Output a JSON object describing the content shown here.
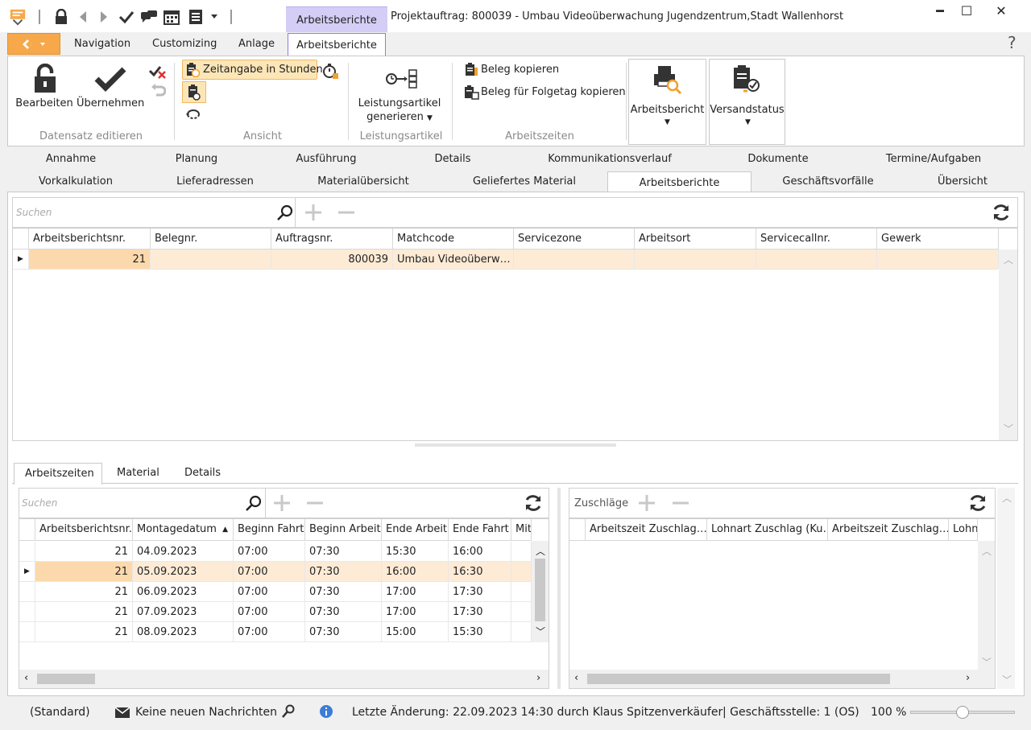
{
  "window": {
    "context_tab": "Arbeitsberichte",
    "title": "Projektauftrag: 800039 - Umbau Videoüberwachung Jugendzentrum,Stadt Wallenhorst",
    "minimize": "━",
    "maximize": "☐",
    "close": "✕"
  },
  "ribbon_tabs": [
    "Navigation",
    "Customizing",
    "Anlage",
    "Arbeitsberichte"
  ],
  "help": "?",
  "ribbon": {
    "edit_label": "Bearbeiten",
    "apply_label": "Übernehmen",
    "group_edit": "Datensatz editieren",
    "time_hours": "Zeitangabe in Stunden",
    "group_view": "Ansicht",
    "generate_line1": "Leistungsartikel",
    "generate_line2": "generieren",
    "group_articles": "Leistungsartikel",
    "copy_doc": "Beleg kopieren",
    "copy_next_day": "Beleg für Folgetag kopieren",
    "group_times": "Arbeitszeiten",
    "report_btn": "Arbeitsbericht",
    "shipping_btn": "Versandstatus"
  },
  "doc_tabs_row1": [
    "Annahme",
    "Planung",
    "Ausführung",
    "Details",
    "Kommunikationsverlauf",
    "Dokumente",
    "Termine/Aufgaben"
  ],
  "doc_tabs_row2": [
    "Vorkalkulation",
    "Lieferadressen",
    "Materialübersicht",
    "Geliefertes Material",
    "Arbeitsberichte",
    "Geschäftsvorfälle",
    "Übersicht"
  ],
  "top_grid": {
    "search_placeholder": "Suchen",
    "columns": [
      "Arbeitsberichtsnr.",
      "Belegnr.",
      "Auftragsnr.",
      "Matchcode",
      "Servicezone",
      "Arbeitsort",
      "Servicecallnr.",
      "Gewerk"
    ],
    "rows": [
      [
        "21",
        "",
        "800039",
        "Umbau Videoüberw…",
        "",
        "",
        "",
        ""
      ]
    ]
  },
  "bottom_tabs": [
    "Arbeitszeiten",
    "Material",
    "Details"
  ],
  "times_grid": {
    "search_placeholder": "Suchen",
    "columns": [
      "Arbeitsberichtsnr.",
      "Montagedatum",
      "Beginn Fahrt",
      "Beginn Arbeit",
      "Ende Arbeit",
      "Ende Fahrt",
      "Mit"
    ],
    "rows": [
      [
        "21",
        "04.09.2023",
        "07:00",
        "07:30",
        "15:30",
        "16:00",
        ""
      ],
      [
        "21",
        "05.09.2023",
        "07:00",
        "07:30",
        "16:00",
        "16:30",
        ""
      ],
      [
        "21",
        "06.09.2023",
        "07:00",
        "07:30",
        "17:00",
        "17:30",
        ""
      ],
      [
        "21",
        "07.09.2023",
        "07:00",
        "07:30",
        "17:00",
        "17:30",
        ""
      ],
      [
        "21",
        "08.09.2023",
        "07:00",
        "07:30",
        "15:00",
        "15:30",
        ""
      ]
    ],
    "selected_row": 1
  },
  "surcharge_grid": {
    "title": "Zuschläge",
    "columns": [
      "Arbeitszeit Zuschlag…",
      "Lohnart Zuschlag (Ku…",
      "Arbeitszeit Zuschlag…",
      "Lohn"
    ]
  },
  "status": {
    "layout": "(Standard)",
    "messages": "Keine neuen Nachrichten",
    "last_change": "Letzte Änderung: 22.09.2023 14:30 durch Klaus Spitzenverkäufer",
    "branch": "| Geschäftsstelle:  1 (OS)",
    "zoom": "100 %",
    "zoom_level": 0.5
  },
  "colors": {
    "accent_orange": "#f6a84a",
    "context_purple": "#d4cdf6",
    "selection": "#fdebd6"
  }
}
